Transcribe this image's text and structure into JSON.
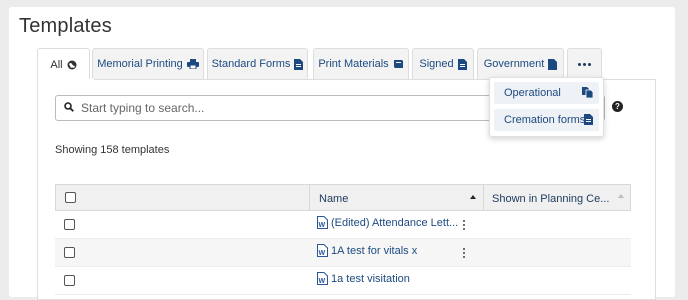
{
  "page": {
    "title": "Templates",
    "search_placeholder": "Start typing to search...",
    "showing_text": "Showing 158 templates"
  },
  "tabs": [
    {
      "label": "All",
      "icon": "globe-icon",
      "active": true
    },
    {
      "label": "Memorial Printing",
      "icon": "print-icon"
    },
    {
      "label": "Standard Forms",
      "icon": "file-icon"
    },
    {
      "label": "Print Materials",
      "icon": "book-icon"
    },
    {
      "label": "Signed",
      "icon": "file-icon"
    },
    {
      "label": "Government",
      "icon": "file-icon"
    },
    {
      "label": "...",
      "icon": "ellipsis-icon"
    }
  ],
  "more_menu": [
    {
      "label": "Operational",
      "icon": "copy-icon"
    },
    {
      "label": "Cremation forms",
      "icon": "file-text-icon"
    }
  ],
  "table": {
    "columns": [
      "Name",
      "Shown in Planning Ce..."
    ],
    "rows": [
      {
        "name": "(Edited) Attendance Lett..."
      },
      {
        "name": "1A test for vitals x"
      },
      {
        "name": "1a test visitation"
      }
    ]
  },
  "colors": {
    "link": "#1c4a80",
    "tab_bg": "#f3f3f3",
    "header_bg": "#f0f0f0"
  }
}
